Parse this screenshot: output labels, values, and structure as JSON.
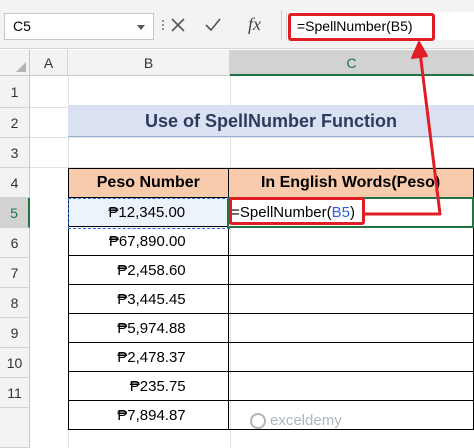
{
  "formula_bar": {
    "name_box": "C5",
    "cancel_icon": "cancel-icon",
    "enter_icon": "enter-icon",
    "fx_label": "fx",
    "formula": "=SpellNumber(B5)"
  },
  "columns": [
    "A",
    "B",
    "C"
  ],
  "selected_column": "C",
  "rows": [
    "1",
    "2",
    "3",
    "4",
    "5",
    "6",
    "7",
    "8",
    "9",
    "10",
    "11"
  ],
  "selected_row": "5",
  "title": "Use of SpellNumber Function",
  "table": {
    "headers": [
      "Peso Number",
      "In English Words(Peso)"
    ],
    "peso_values": [
      "₱12,345.00",
      "₱67,890.00",
      "₱2,458.60",
      "₱3,445.45",
      "₱5,974.88",
      "₱2,478.37",
      "₱235.75",
      "₱7,894.87"
    ],
    "editing_cell": {
      "prefix": "=SpellNumber(",
      "ref": "B5",
      "suffix": ")"
    }
  },
  "watermark": "exceldemy",
  "colors": {
    "annotation_red": "#e11e25",
    "title_fill": "#d9e1f2",
    "header_fill": "#f8cbad",
    "selection_green": "#217346",
    "reference_blue": "#2a64d8"
  }
}
